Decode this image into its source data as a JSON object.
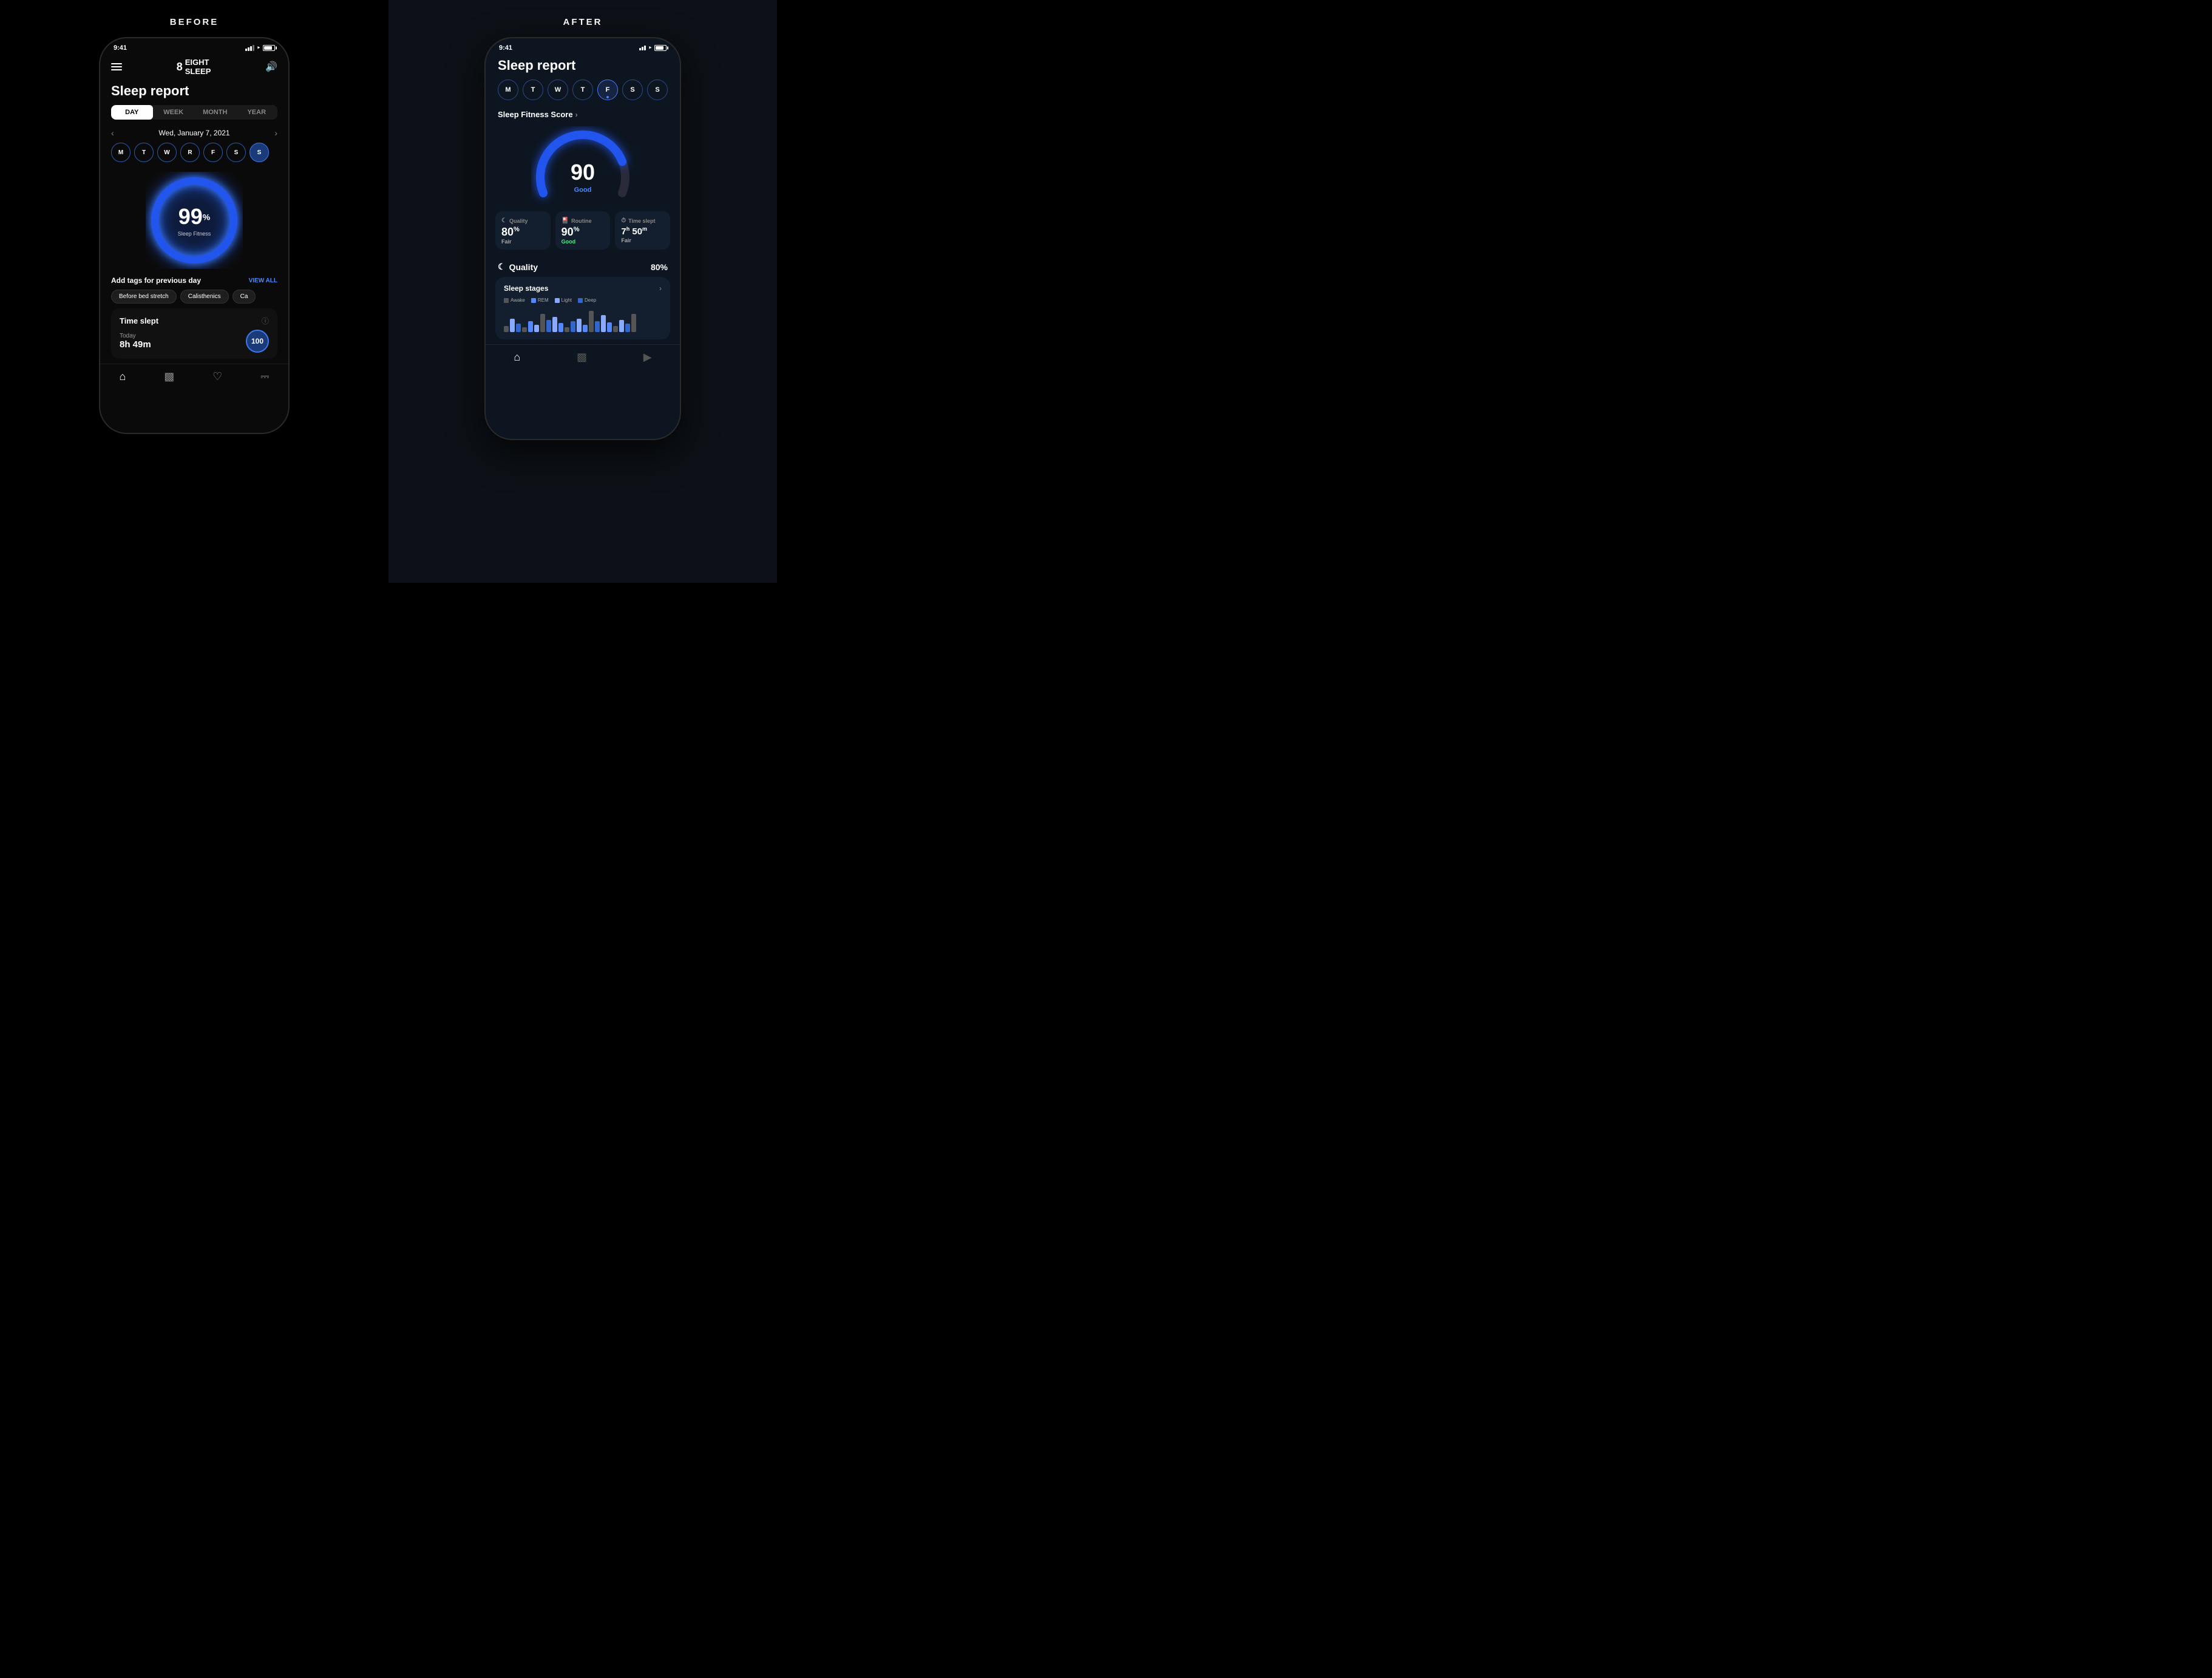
{
  "layout": {
    "before_label": "BEFORE",
    "after_label": "AFTER"
  },
  "left_phone": {
    "status_time": "9:41",
    "header": {
      "brand": "8EIGHT\nSLEEP"
    },
    "page_title": "Sleep report",
    "time_tabs": [
      "DAY",
      "WEEK",
      "MONTH",
      "YEAR"
    ],
    "active_tab": "DAY",
    "date": "Wed, January 7, 2021",
    "days": [
      "M",
      "T",
      "W",
      "R",
      "F",
      "S",
      "S"
    ],
    "active_day": "S",
    "score": "99",
    "score_label": "Sleep Fitness",
    "tags_title": "Add tags for previous day",
    "view_all": "VIEW ALL",
    "tags": [
      "Before bed stretch",
      "Calisthenics",
      "Ca"
    ],
    "time_slept_title": "Time slept",
    "today_label": "Today",
    "today_value": "8h 49m",
    "score_badge": "100",
    "nav_items": [
      "home",
      "chart",
      "heart",
      "wave"
    ]
  },
  "right_phone": {
    "status_time": "9:41",
    "page_title": "Sleep report",
    "days": [
      "M",
      "T",
      "W",
      "T",
      "F",
      "S",
      "S"
    ],
    "active_day": "F",
    "fitness_score_label": "Sleep Fitness Score",
    "big_score": "90",
    "big_score_label": "Good",
    "metrics": [
      {
        "icon": "moon",
        "label": "Quality",
        "value": "80",
        "unit": "%",
        "sub": "Fair",
        "sub_color": "fair"
      },
      {
        "icon": "bed",
        "label": "Routine",
        "value": "90",
        "unit": "%",
        "sub": "Good",
        "sub_color": "good"
      },
      {
        "icon": "clock",
        "label": "Time slept",
        "value": "7",
        "unit2": "h",
        "value2": "50",
        "unit3": "m",
        "sub": "Fair",
        "sub_color": "fair"
      }
    ],
    "quality_label": "Quality",
    "quality_percent": "80%",
    "stages_title": "Sleep stages",
    "legend": [
      {
        "label": "Awake",
        "color": "awake"
      },
      {
        "label": "REM",
        "color": "rem"
      },
      {
        "label": "Light",
        "color": "light"
      },
      {
        "label": "Deep",
        "color": "deep"
      }
    ],
    "nav_items": [
      "home",
      "chart",
      "play"
    ]
  }
}
